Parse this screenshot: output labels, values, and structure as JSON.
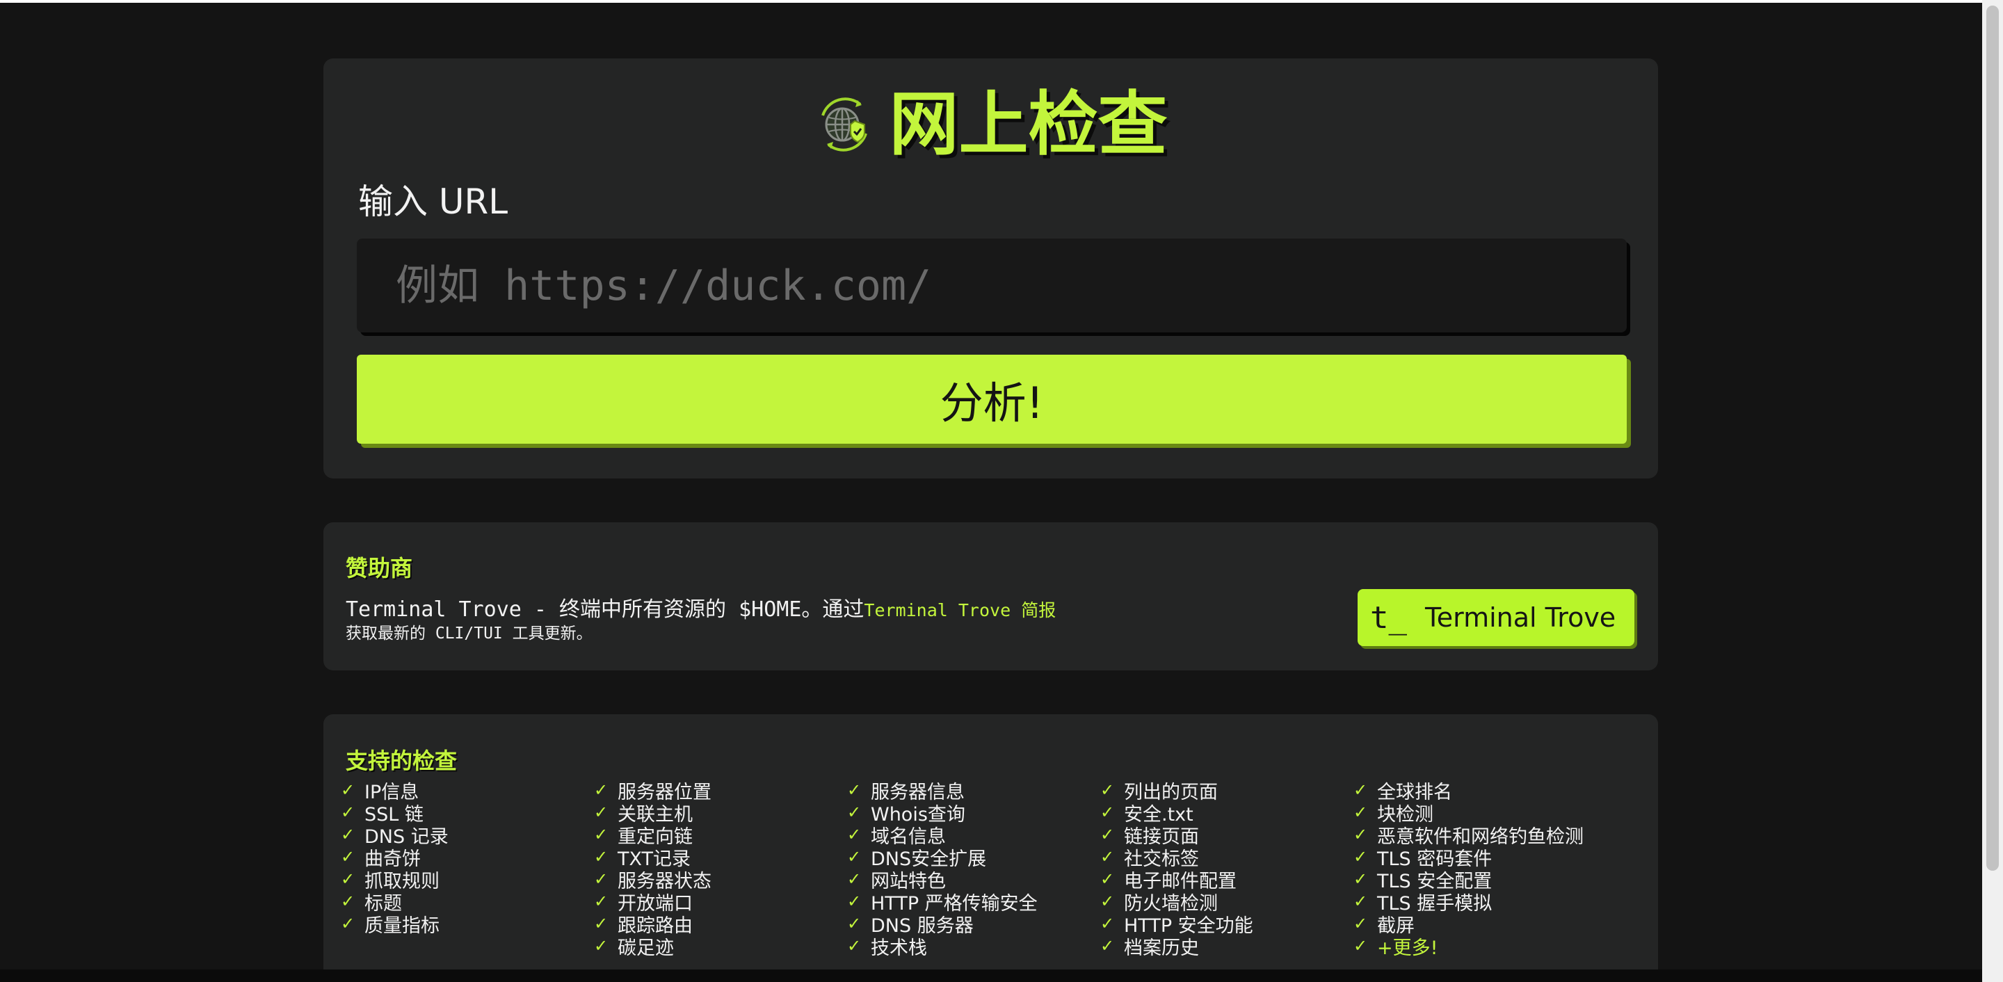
{
  "hero": {
    "title": "网上检查",
    "url_label": "输入 URL",
    "url_placeholder": "例如 https://duck.com/",
    "analyze_label": "分析!"
  },
  "sponsor": {
    "heading": "赞助商",
    "line1_text": "Terminal Trove - 终端中所有资源的 $HOME。通过",
    "line1_link": "Terminal Trove 简报",
    "line2_text": "获取最新的 CLI/TUI 工具更新。",
    "button_logo": "t_",
    "button_label": "Terminal Trove"
  },
  "checks": {
    "heading": "支持的检查",
    "check_symbol": "✓",
    "columns": [
      [
        "IP信息",
        "SSL 链",
        "DNS 记录",
        "曲奇饼",
        "抓取规则",
        "标题",
        "质量指标"
      ],
      [
        "服务器位置",
        "关联主机",
        "重定向链",
        "TXT记录",
        "服务器状态",
        "开放端口",
        "跟踪路由",
        "碳足迹"
      ],
      [
        "服务器信息",
        "Whois查询",
        "域名信息",
        "DNS安全扩展",
        "网站特色",
        "HTTP 严格传输安全",
        "DNS 服务器",
        "技术栈"
      ],
      [
        "列出的页面",
        "安全.txt",
        "链接页面",
        "社交标签",
        "电子邮件配置",
        "防火墙检测",
        "HTTP 安全功能",
        "档案历史"
      ],
      [
        "全球排名",
        "块检测",
        "恶意软件和网络钓鱼检测",
        "TLS 密码套件",
        "TLS 安全配置",
        "TLS 握手模拟",
        "截屏",
        "+更多!"
      ]
    ]
  },
  "colors": {
    "accent": "#c3f53c",
    "background": "#141414",
    "card": "#242525",
    "input": "#181818"
  },
  "icons": {
    "logo": "globe-shield-icon",
    "check": "check-icon"
  }
}
